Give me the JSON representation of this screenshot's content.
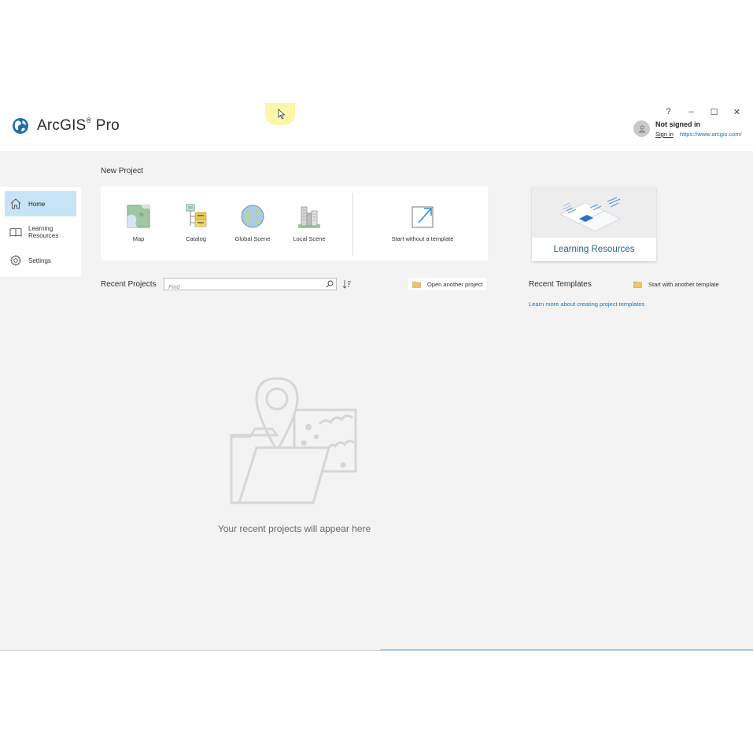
{
  "app": {
    "name": "ArcGIS",
    "reg_mark": "®",
    "product": " Pro"
  },
  "window_controls": {
    "help": "?",
    "minimize": "–",
    "maximize": "☐",
    "close": "✕"
  },
  "user": {
    "status": "Not signed in",
    "sign_in_label": "Sign in",
    "portal_url": "https://www.arcgis.com/"
  },
  "sidebar": {
    "items": [
      {
        "label": "Home",
        "icon": "home-icon",
        "active": true
      },
      {
        "label": "Learning Resources",
        "icon": "book-icon",
        "active": false
      },
      {
        "label": "Settings",
        "icon": "gear-icon",
        "active": false
      }
    ],
    "learning_line1": "Learning",
    "learning_line2": "Resources"
  },
  "new_project": {
    "title": "New Project",
    "templates": [
      {
        "label": "Map",
        "icon": "map-icon"
      },
      {
        "label": "Catalog",
        "icon": "catalog-icon"
      },
      {
        "label": "Global Scene",
        "icon": "globe-icon"
      },
      {
        "label": "Local Scene",
        "icon": "local-scene-icon"
      }
    ],
    "blank_label": "Start without a template"
  },
  "learning_card": {
    "label": "Learning Resources"
  },
  "recent_projects": {
    "title": "Recent Projects",
    "find_placeholder": "Find",
    "open_label": "Open another project",
    "empty_message": "Your recent projects will appear here"
  },
  "recent_templates": {
    "title": "Recent Templates",
    "start_label": "Start with another template",
    "learn_more": "Learn more about creating project templates"
  },
  "colors": {
    "accent": "#1a74b5",
    "active_bg": "#c6e4f6",
    "background": "#f3f3f3"
  }
}
